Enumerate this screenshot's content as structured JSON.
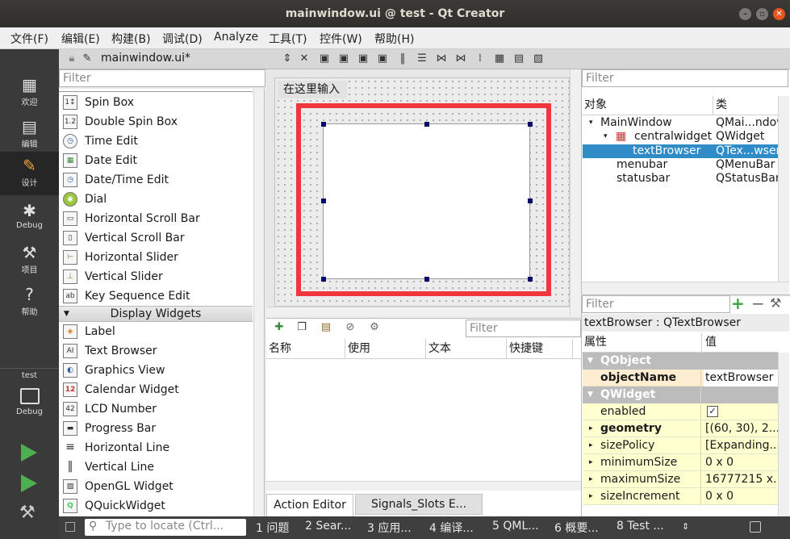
{
  "window": {
    "title": "mainwindow.ui @ test - Qt Creator"
  },
  "menu": [
    "文件(F)",
    "编辑(E)",
    "构建(B)",
    "调试(D)",
    "Analyze",
    "工具(T)",
    "控件(W)",
    "帮助(H)"
  ],
  "modes": [
    {
      "label": "欢迎",
      "icon": "grid-icon"
    },
    {
      "label": "编辑",
      "icon": "document-icon"
    },
    {
      "label": "设计",
      "icon": "pencil-icon"
    },
    {
      "label": "Debug",
      "icon": "bug-icon"
    },
    {
      "label": "项目",
      "icon": "wrench-icon"
    },
    {
      "label": "帮助",
      "icon": "help-icon"
    }
  ],
  "target": {
    "project": "test",
    "config": "Debug"
  },
  "editor": {
    "file": "mainwindow.ui*"
  },
  "widgetbox": {
    "filter_placeholder": "Filter",
    "items_top": [
      {
        "label": "Spin Box",
        "icon": "1↕"
      },
      {
        "label": "Double Spin Box",
        "icon": "1.2"
      },
      {
        "label": "Time Edit",
        "icon": "◷"
      },
      {
        "label": "Date Edit",
        "icon": "▦"
      },
      {
        "label": "Date/Time Edit",
        "icon": "◷"
      },
      {
        "label": "Dial",
        "icon": "◉"
      },
      {
        "label": "Horizontal Scroll Bar",
        "icon": "▭"
      },
      {
        "label": "Vertical Scroll Bar",
        "icon": "▯"
      },
      {
        "label": "Horizontal Slider",
        "icon": "⊢"
      },
      {
        "label": "Vertical Slider",
        "icon": "⊥"
      },
      {
        "label": "Key Sequence Edit",
        "icon": "ab"
      }
    ],
    "category": "Display Widgets",
    "items_bottom": [
      {
        "label": "Label",
        "icon": "◈"
      },
      {
        "label": "Text Browser",
        "icon": "AI"
      },
      {
        "label": "Graphics View",
        "icon": "◐"
      },
      {
        "label": "Calendar Widget",
        "icon": "12"
      },
      {
        "label": "LCD Number",
        "icon": "42"
      },
      {
        "label": "Progress Bar",
        "icon": "▬"
      },
      {
        "label": "Horizontal Line",
        "icon": "≡"
      },
      {
        "label": "Vertical Line",
        "icon": "‖"
      },
      {
        "label": "OpenGL Widget",
        "icon": "▨"
      },
      {
        "label": "QQuickWidget",
        "icon": "Q"
      }
    ]
  },
  "form": {
    "menu_placeholder": "在这里输入"
  },
  "action_editor": {
    "filter_placeholder": "Filter",
    "columns": [
      "名称",
      "使用",
      "文本",
      "快捷键"
    ],
    "tabs": [
      "Action Editor",
      "Signals_Slots E..."
    ]
  },
  "object_inspector": {
    "filter_placeholder": "Filter",
    "columns": [
      "对象",
      "类"
    ],
    "rows": [
      {
        "object": "MainWindow",
        "class": "QMai...ndow"
      },
      {
        "object": "centralwidget",
        "class": "QWidget"
      },
      {
        "object": "textBrowser",
        "class": "QTex...wser"
      },
      {
        "object": "menubar",
        "class": "QMenuBar"
      },
      {
        "object": "statusbar",
        "class": "QStatusBar"
      }
    ]
  },
  "property_editor": {
    "filter_placeholder": "Filter",
    "context": "textBrowser : QTextBrowser",
    "columns": [
      "属性",
      "值"
    ],
    "sections": [
      {
        "name": "QObject",
        "props": [
          {
            "name": "objectName",
            "value": "textBrowser"
          }
        ]
      },
      {
        "name": "QWidget",
        "props": [
          {
            "name": "enabled",
            "value": "✓"
          },
          {
            "name": "geometry",
            "value": "[(60, 30), 2..."
          },
          {
            "name": "sizePolicy",
            "value": "[Expanding..."
          },
          {
            "name": "minimumSize",
            "value": "0 x 0"
          },
          {
            "name": "maximumSize",
            "value": "16777215 x..."
          },
          {
            "name": "sizeIncrement",
            "value": "0 x 0"
          }
        ]
      }
    ]
  },
  "statusbar": {
    "locator_placeholder": "Type to locate (Ctrl...",
    "panes": [
      "1 问题",
      "2 Sear...",
      "3 应用...",
      "4 编译...",
      "5 QML...",
      "6 概要...",
      "8 Test ..."
    ]
  },
  "colors": {
    "highlight": "#f1353c",
    "selection": "#308cc6",
    "modebar": "#3a3a3a"
  }
}
